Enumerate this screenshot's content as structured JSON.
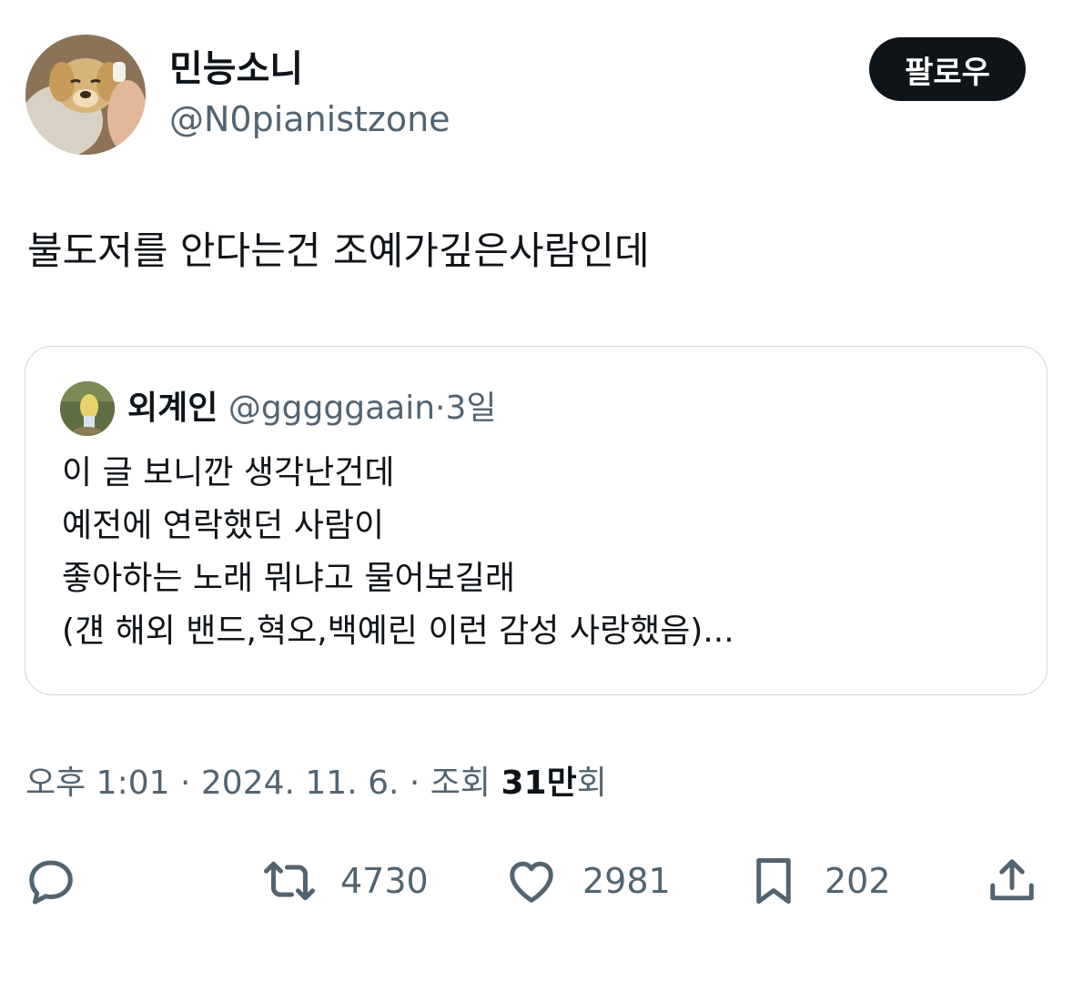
{
  "author": {
    "display_name": "민능소니",
    "handle": "@N0pianistzone",
    "avatar_icon": "puppy-avatar"
  },
  "follow_label": "팔로우",
  "tweet_text": "불도저를 안다는건 조예가깊은사람인데",
  "quote": {
    "display_name": "외계인",
    "handle": "@gggggaain",
    "dot": "·",
    "time": "3일",
    "lines": [
      "이 글 보니깐 생각난건데",
      "예전에 연락했던 사람이",
      "좋아하는 노래 뭐냐고 물어보길래",
      "(걘 해외 밴드,혁오,백예린 이런 감성 사랑했음)..."
    ]
  },
  "meta": {
    "time": "오후 1:01",
    "sep1": "·",
    "date": "2024. 11. 6.",
    "sep2": "·",
    "views_label": "조회",
    "views_num": "31만",
    "views_suffix": "회"
  },
  "actions": {
    "reply_icon": "reply-icon",
    "retweet_count": "4730",
    "like_count": "2981",
    "bookmark_count": "202",
    "share_icon": "share-icon"
  },
  "colors": {
    "text": "#0f1419",
    "secondary": "#536471",
    "border": "#cfd9de",
    "button_bg": "#0f1419"
  }
}
